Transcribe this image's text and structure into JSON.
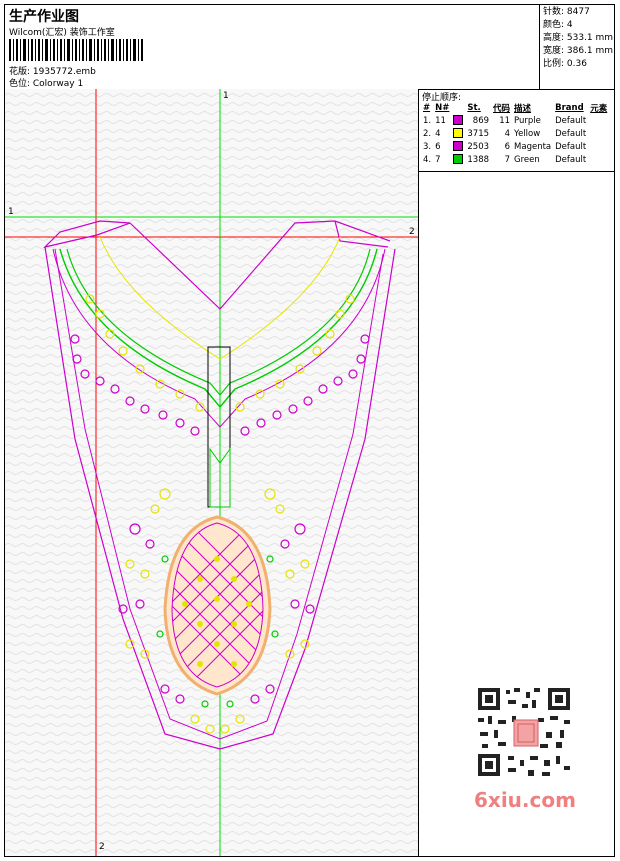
{
  "header": {
    "title": "生产作业图",
    "company": "Wilcom(汇宏) 装饰工作室",
    "design_label": "花版: 1935772.emb",
    "colorway_label": "色位: Colorway 1"
  },
  "info": {
    "stitches": "针数: 8477",
    "colors": "颜色: 4",
    "height": "高度: 533.1 mm",
    "width": "宽度: 386.1 mm",
    "scale": "比例: 0.36"
  },
  "stop_sequence": {
    "title": "停止顺序:",
    "headers": [
      "#",
      "N#",
      "St.",
      "代码",
      "描述",
      "Brand",
      "元素"
    ],
    "rows": [
      {
        "num": "1.",
        "n": "11",
        "color": "#cc00cc",
        "st": "869",
        "code": "11",
        "desc": "Purple",
        "brand": "Default"
      },
      {
        "num": "2.",
        "n": "4",
        "color": "#ffff00",
        "st": "3715",
        "code": "4",
        "desc": "Yellow",
        "brand": "Default"
      },
      {
        "num": "3.",
        "n": "6",
        "color": "#cc00cc",
        "st": "2503",
        "code": "6",
        "desc": "Magenta",
        "brand": "Default"
      },
      {
        "num": "4.",
        "n": "7",
        "color": "#00cc00",
        "st": "1388",
        "code": "7",
        "desc": "Green",
        "brand": "Default"
      }
    ]
  },
  "axes": {
    "top": "1",
    "left": "1",
    "right": "2",
    "bottom": "2"
  },
  "watermark": "6xiu.com",
  "colors": {
    "purple": "#cc00cc",
    "yellow": "#ffff00",
    "green": "#00cc00",
    "red_guide": "#ff0000",
    "green_guide": "#00dd00"
  }
}
